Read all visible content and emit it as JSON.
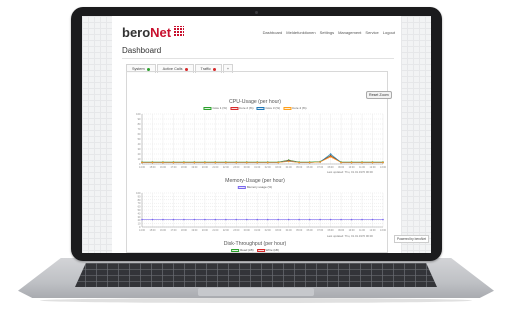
{
  "app": {
    "logo_text": "bero",
    "logo_accent": "Net",
    "nav": [
      "Dashboard",
      "Meldefunktionen",
      "Settings",
      "Management",
      "Service",
      "Logout"
    ]
  },
  "page": {
    "title": "Dashboard",
    "tabs": [
      {
        "label": "System",
        "dot": "#2ca02c"
      },
      {
        "label": "Active Calls",
        "dot": "#d62728"
      },
      {
        "label": "Traffic",
        "dot": "#d62728"
      },
      {
        "label": "+",
        "dot": null
      }
    ],
    "reset_label": "Reset Zoom",
    "footer_badge": "Powered by beroNet"
  },
  "chart_data": [
    {
      "type": "line",
      "title": "CPU-Usage (per hour)",
      "series": [
        {
          "name": "Core 1 (%)",
          "color": "#2ca02c",
          "values": [
            4,
            4,
            4,
            4,
            4,
            4,
            4,
            4,
            4,
            4,
            4,
            4,
            4,
            4,
            8,
            4,
            4,
            5,
            17,
            4,
            4,
            4,
            4,
            4
          ]
        },
        {
          "name": "Core 2 (%)",
          "color": "#d62728",
          "values": [
            3,
            3,
            3,
            3,
            3,
            3,
            3,
            3,
            3,
            3,
            3,
            3,
            3,
            3,
            7,
            3,
            3,
            4,
            16,
            3,
            3,
            3,
            3,
            3
          ]
        },
        {
          "name": "Core 3 (%)",
          "color": "#1f77b4",
          "values": [
            3,
            3,
            3,
            3,
            3,
            3,
            3,
            3,
            3,
            3,
            3,
            3,
            3,
            3,
            6,
            3,
            3,
            4,
            20,
            3,
            3,
            3,
            3,
            3
          ]
        },
        {
          "name": "Core 4 (%)",
          "color": "#ff9f1a",
          "values": [
            3,
            3,
            3,
            3,
            3,
            3,
            3,
            3,
            3,
            3,
            3,
            3,
            3,
            3,
            5,
            3,
            3,
            4,
            14,
            3,
            3,
            3,
            3,
            3
          ]
        }
      ],
      "ylim": [
        0,
        100
      ],
      "yticks": [
        "100",
        "90",
        "80",
        "70",
        "60",
        "50",
        "40",
        "30",
        "20",
        "10",
        "0"
      ],
      "x_labels": [
        "14:00",
        "15:00",
        "16:00",
        "17:00",
        "18:00",
        "19:00",
        "20:00",
        "21:00",
        "22:00",
        "23:00",
        "00:00",
        "01:00",
        "02:00",
        "03:00",
        "04:00",
        "05:00",
        "06:00",
        "07:00",
        "08:00",
        "09:00",
        "10:00",
        "11:00",
        "12:00",
        "13:00"
      ],
      "note": "Last updated: Thu, 01.01.1970 00:00"
    },
    {
      "type": "line",
      "title": "Memory-Usage (per hour)",
      "series": [
        {
          "name": "Memory usage (%)",
          "color": "#7b68ee",
          "values": [
            22,
            22,
            22,
            22,
            22,
            22,
            22,
            22,
            22,
            22,
            22,
            22,
            22,
            22,
            22,
            22,
            22,
            22,
            22,
            22,
            22,
            22,
            22,
            22
          ]
        }
      ],
      "ylim": [
        0,
        100
      ],
      "yticks": [
        "100",
        "90",
        "80",
        "70",
        "60",
        "50",
        "40",
        "30",
        "20",
        "10",
        "0"
      ],
      "x_labels": [
        "14:00",
        "15:00",
        "16:00",
        "17:00",
        "18:00",
        "19:00",
        "20:00",
        "21:00",
        "22:00",
        "23:00",
        "00:00",
        "01:00",
        "02:00",
        "03:00",
        "04:00",
        "05:00",
        "06:00",
        "07:00",
        "08:00",
        "09:00",
        "10:00",
        "11:00",
        "12:00",
        "13:00"
      ],
      "note": "Last updated: Thu, 01.01.1970 00:00"
    },
    {
      "type": "line",
      "title": "Disk-Throughput (per hour)",
      "series": [
        {
          "name": "Read (kB)",
          "color": "#2ca02c",
          "values": []
        },
        {
          "name": "Write (kB)",
          "color": "#d62728",
          "values": []
        }
      ]
    }
  ]
}
